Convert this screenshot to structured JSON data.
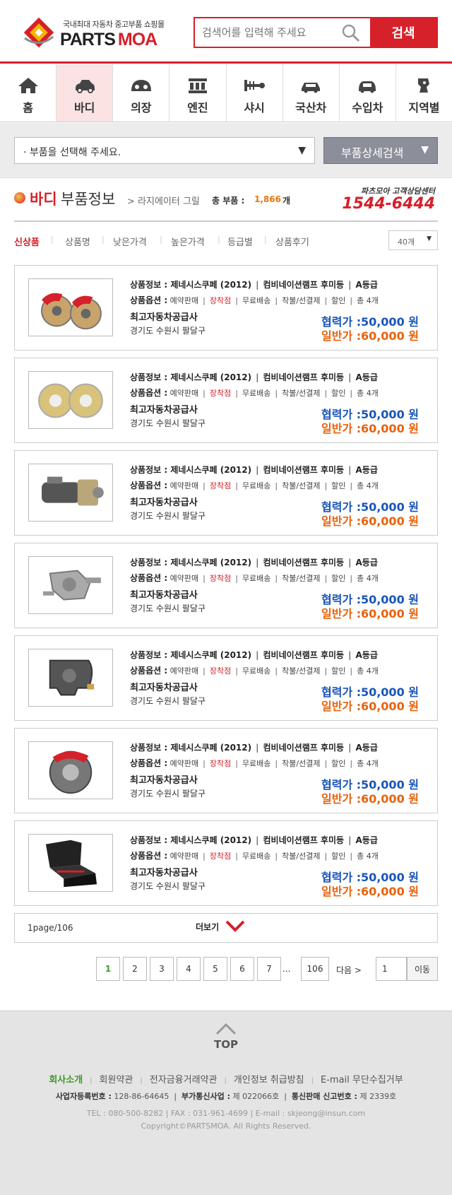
{
  "header": {
    "logo_tagline": "국내최대 자동차 중고부품 쇼핑몰",
    "logo_parts": "PARTS",
    "logo_moa": "MOA",
    "search_placeholder": "검색어를 입력해 주세요",
    "search_button": "검색"
  },
  "categories": [
    {
      "label": "홈",
      "icon": "home-icon"
    },
    {
      "label": "바디",
      "icon": "car-body-icon",
      "active": true
    },
    {
      "label": "의장",
      "icon": "dashboard-icon"
    },
    {
      "label": "엔진",
      "icon": "engine-icon"
    },
    {
      "label": "샤시",
      "icon": "chassis-icon"
    },
    {
      "label": "국산차",
      "icon": "domestic-car-icon"
    },
    {
      "label": "수입차",
      "icon": "import-car-icon"
    },
    {
      "label": "지역별",
      "icon": "region-map-icon"
    }
  ],
  "filter": {
    "part_select": "· 부품을 선택해 주세요.",
    "detail_search": "부품상세검색"
  },
  "section": {
    "category": "바디",
    "title": "부품정보",
    "subcategory": "> 라지에이터 그릴",
    "count_label": "총 부품 :",
    "count": "1,866",
    "count_unit": "개",
    "cs_label": "파츠모아 고객상담센터",
    "cs_phone": "1544-6444"
  },
  "sort_tabs": [
    "신상품",
    "상품명",
    "낮은가격",
    "높은가격",
    "등급별",
    "상품후기"
  ],
  "per_page": "40개",
  "products": [
    {
      "image": "brake-caliper-disc",
      "info_label": "상품정보 :",
      "car": "제네시스쿠페 (2012)",
      "part": "컴비네이션램프 후미등",
      "grade": "A등급",
      "option_label": "상품옵션 :",
      "opt1": "예약판매",
      "opt2": "장착점",
      "opt3": "무료배송",
      "opt4": "착불/선결제",
      "opt5": "할인",
      "opt6": "총 4개",
      "seller": "최고자동차공급사",
      "address": "경기도 수원시 팔달구",
      "price1_label": "협력가 :",
      "price1": "50,000 원",
      "price2_label": "일반가 :",
      "price2": "60,000 원"
    },
    {
      "image": "gold-brake-rotors",
      "info_label": "상품정보 :",
      "car": "제네시스쿠페 (2012)",
      "part": "컴비네이션램프 후미등",
      "grade": "A등급",
      "option_label": "상품옵션 :",
      "opt1": "예약판매",
      "opt2": "장착점",
      "opt3": "무료배송",
      "opt4": "착불/선결제",
      "opt5": "할인",
      "opt6": "총 4개",
      "seller": "최고자동차공급사",
      "address": "경기도 수원시 팔달구",
      "price1_label": "협력가 :",
      "price1": "50,000 원",
      "price2_label": "일반가 :",
      "price2": "60,000 원"
    },
    {
      "image": "starter-motor",
      "info_label": "상품정보 :",
      "car": "제네시스쿠페 (2012)",
      "part": "컴비네이션램프 후미등",
      "grade": "A등급",
      "option_label": "상품옵션 :",
      "opt1": "예약판매",
      "opt2": "장착점",
      "opt3": "무료배송",
      "opt4": "착불/선결제",
      "opt5": "할인",
      "opt6": "총 4개",
      "seller": "최고자동차공급사",
      "address": "경기도 수원시 팔달구",
      "price1_label": "협력가 :",
      "price1": "50,000 원",
      "price2_label": "일반가 :",
      "price2": "60,000 원"
    },
    {
      "image": "water-pump",
      "info_label": "상품정보 :",
      "car": "제네시스쿠페 (2012)",
      "part": "컴비네이션램프 후미등",
      "grade": "A등급",
      "option_label": "상품옵션 :",
      "opt1": "예약판매",
      "opt2": "장착점",
      "opt3": "무료배송",
      "opt4": "착불/선결제",
      "opt5": "할인",
      "opt6": "총 4개",
      "seller": "최고자동차공급사",
      "address": "경기도 수원시 팔달구",
      "price1_label": "협력가 :",
      "price1": "50,000 원",
      "price2_label": "일반가 :",
      "price2": "60,000 원"
    },
    {
      "image": "brake-caliper",
      "info_label": "상품정보 :",
      "car": "제네시스쿠페 (2012)",
      "part": "컴비네이션램프 후미등",
      "grade": "A등급",
      "option_label": "상품옵션 :",
      "opt1": "예약판매",
      "opt2": "장착점",
      "opt3": "무료배송",
      "opt4": "착불/선결제",
      "opt5": "할인",
      "opt6": "총 4개",
      "seller": "최고자동차공급사",
      "address": "경기도 수원시 팔달구",
      "price1_label": "협력가 :",
      "price1": "50,000 원",
      "price2_label": "일반가 :",
      "price2": "60,000 원"
    },
    {
      "image": "brake-disc-red-caliper",
      "info_label": "상품정보 :",
      "car": "제네시스쿠페 (2012)",
      "part": "컴비네이션램프 후미등",
      "grade": "A등급",
      "option_label": "상품옵션 :",
      "opt1": "예약판매",
      "opt2": "장착점",
      "opt3": "무료배송",
      "opt4": "착불/선결제",
      "opt5": "할인",
      "opt6": "총 4개",
      "seller": "최고자동차공급사",
      "address": "경기도 수원시 팔달구",
      "price1_label": "협력가 :",
      "price1": "50,000 원",
      "price2_label": "일반가 :",
      "price2": "60,000 원"
    },
    {
      "image": "rear-seat",
      "info_label": "상품정보 :",
      "car": "제네시스쿠페 (2012)",
      "part": "컴비네이션램프 후미등",
      "grade": "A등급",
      "option_label": "상품옵션 :",
      "opt1": "예약판매",
      "opt2": "장착점",
      "opt3": "무료배송",
      "opt4": "착불/선결제",
      "opt5": "할인",
      "opt6": "총 4개",
      "seller": "최고자동차공급사",
      "address": "경기도 수원시 팔달구",
      "price1_label": "협력가 :",
      "price1": "50,000 원",
      "price2_label": "일반가 :",
      "price2": "60,000 원"
    }
  ],
  "more": {
    "page_info": "1page/106",
    "label": "더보기"
  },
  "pagination": {
    "pages": [
      "1",
      "2",
      "3",
      "4",
      "5",
      "6",
      "7"
    ],
    "dots": "...",
    "last": "106",
    "next": "다음 >",
    "input_value": "1",
    "go": "이동"
  },
  "footer": {
    "top_label": "TOP",
    "links": [
      "회사소개",
      "회원약관",
      "전자금융거래약관",
      "개인정보 취급방침",
      "E-mail 무단수집거부"
    ],
    "biz_no_label": "사업자등록번호 :",
    "biz_no": "128-86-64645",
    "telecom_label": "부가통신사업 :",
    "telecom": "제 022066호",
    "mail_order_label": "통신판매 신고번호 :",
    "mail_order": "제 2339호",
    "contact": "TEL : 080-500-8282  |  FAX : 031-961-4699  |  E-mail : skjeong@insun.com",
    "copyright": "Copyright©PARTSMOA. All Rights Reserved."
  },
  "colors": {
    "brand_red": "#d6202a",
    "price_blue": "#1a55b8",
    "price_orange": "#e8620c",
    "active_green": "#3e9a2b"
  }
}
